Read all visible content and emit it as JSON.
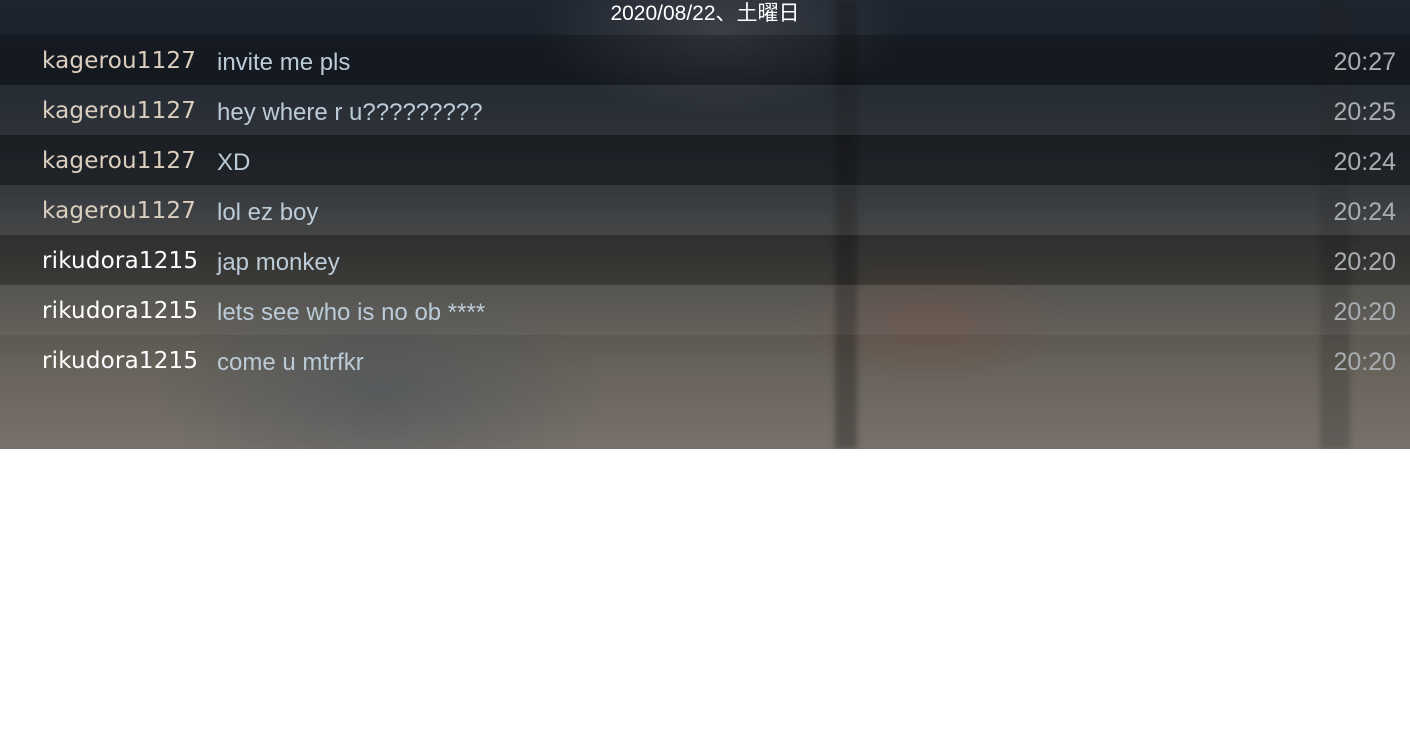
{
  "chat": {
    "date_header": "2020/08/22、土曜日",
    "messages": [
      {
        "sender": "kagerou1127",
        "text": "invite me pls",
        "time": "20:27"
      },
      {
        "sender": "kagerou1127",
        "text": "hey where r u?????????",
        "time": "20:25"
      },
      {
        "sender": "kagerou1127",
        "text": "XD",
        "time": "20:24"
      },
      {
        "sender": "kagerou1127",
        "text": "lol ez boy",
        "time": "20:24"
      },
      {
        "sender": "rikudora1215",
        "text": "jap monkey",
        "time": "20:20"
      },
      {
        "sender": "rikudora1215",
        "text": "lets see who is no ob ****",
        "time": "20:20"
      },
      {
        "sender": "rikudora1215",
        "text": "come u mtrfkr",
        "time": "20:20"
      }
    ]
  },
  "colors": {
    "friend_name": "#dccfc0",
    "self_name": "#ffffff",
    "message_text": "#bccbd8",
    "timestamp": "#a8adb2"
  }
}
